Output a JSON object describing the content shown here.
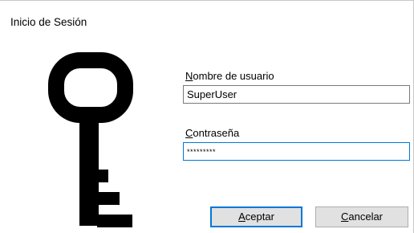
{
  "window": {
    "title": "Inicio de Sesión"
  },
  "icons": {
    "main": "key-icon"
  },
  "form": {
    "username": {
      "label_access_key": "N",
      "label_rest": "ombre de usuario",
      "value": "SuperUser"
    },
    "password": {
      "label_access_key": "C",
      "label_rest": "ontraseña",
      "value": "*********"
    }
  },
  "buttons": {
    "accept": {
      "access_key": "A",
      "rest": "ceptar"
    },
    "cancel": {
      "access_key": "C",
      "rest": "ancelar"
    }
  },
  "colors": {
    "focus_border": "#0078d7",
    "button_face": "#e1e1e1",
    "key_fill": "#000000"
  }
}
